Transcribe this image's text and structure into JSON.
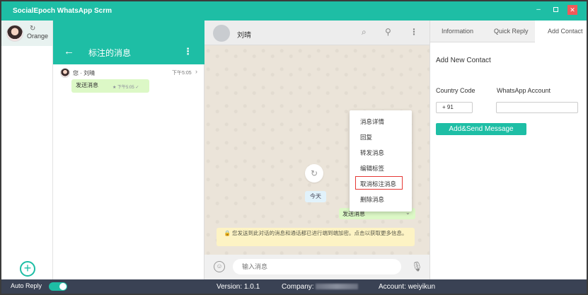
{
  "app": {
    "title": "SocialEpoch WhatsApp Scrm"
  },
  "window": {
    "minimize": "–",
    "close": "✕"
  },
  "accounts": {
    "active_name": "Orange",
    "refresh_icon": "refresh-icon",
    "add_label": "+"
  },
  "starred": {
    "title": "标注的消息",
    "back_icon": "←",
    "menu_icon": "⋮",
    "items": [
      {
        "from": "您 · 刘晴",
        "time": "下午5:05",
        "text": "发送消息",
        "meta": "★ 下午5:05 ✓"
      }
    ]
  },
  "chat": {
    "contact_name": "刘晴",
    "date_chip": "今天",
    "outgoing_text": "发送消息",
    "notice": "🔒 您发送到此对话的消息和通话都已进行端到端加密。点击以获取更多信息。",
    "input_placeholder": "输入消息",
    "context_menu": [
      "消息详情",
      "回复",
      "转发消息",
      "编辑标签",
      "取消标注消息",
      "删除消息"
    ]
  },
  "right_panel": {
    "tabs": [
      "Information",
      "Quick Reply",
      "Add Contact"
    ],
    "active_tab": "Add Contact",
    "form_title": "Add New Contact",
    "country_code_label": "Country Code",
    "country_code_value": "+ 91",
    "account_label": "WhatsApp Account",
    "account_value": "",
    "send_button": "Add&Send Message"
  },
  "statusbar": {
    "auto_reply_label": "Auto Reply",
    "auto_reply_on": true,
    "version": "Version: 1.0.1",
    "company_label": "Company:",
    "account": "Account: weiyikun"
  },
  "colors": {
    "accent": "#1ebea5",
    "statusbar": "#3a4254",
    "bubble_out": "#dcf8c6",
    "highlight": "#e53935"
  }
}
